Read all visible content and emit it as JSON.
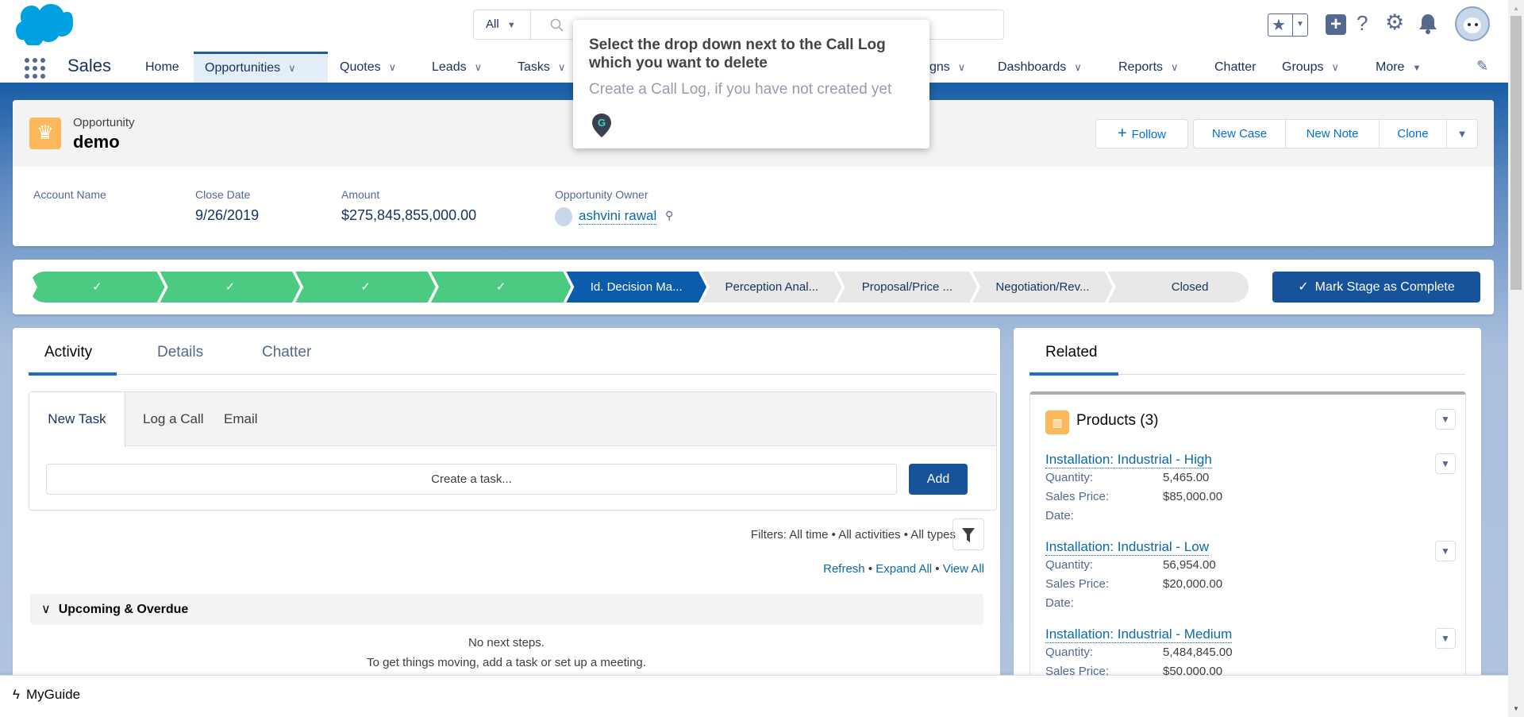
{
  "header": {
    "search_scope": "All",
    "search_placeholder": "",
    "icons": [
      "salesforce-cloud-logo",
      "search-icon",
      "favorites-star-icon",
      "global-create-plus-icon",
      "help-icon",
      "setup-gear-icon",
      "notifications-bell-icon",
      "user-avatar"
    ]
  },
  "nav": {
    "app_name": "Sales",
    "items": [
      {
        "label": "Home",
        "chevron": false
      },
      {
        "label": "Opportunities",
        "chevron": true,
        "active": true
      },
      {
        "label": "Quotes",
        "chevron": true
      },
      {
        "label": "Leads",
        "chevron": true
      },
      {
        "label": "Tasks",
        "chevron": true
      },
      {
        "label": "gns",
        "chevron": true
      },
      {
        "label": "Dashboards",
        "chevron": true
      },
      {
        "label": "Reports",
        "chevron": true
      },
      {
        "label": "Chatter",
        "chevron": false
      },
      {
        "label": "Groups",
        "chevron": true
      },
      {
        "label": "More",
        "chevron": true
      }
    ]
  },
  "tooltip": {
    "title": "Select the drop down next to the Call Log which you want to delete",
    "subtitle": "Create a Call Log, if you have not created yet"
  },
  "record": {
    "object_type": "Opportunity",
    "name": "demo",
    "actions": {
      "follow": "Follow",
      "new_case": "New Case",
      "new_note": "New Note",
      "clone": "Clone"
    },
    "fields": [
      {
        "label": "Account Name",
        "value": ""
      },
      {
        "label": "Close Date",
        "value": "9/26/2019"
      },
      {
        "label": "Amount",
        "value": "$275,845,855,000.00"
      },
      {
        "label": "Opportunity Owner",
        "value": "ashvini rawal"
      }
    ]
  },
  "path": {
    "stages": [
      {
        "label": "",
        "status": "complete"
      },
      {
        "label": "",
        "status": "complete"
      },
      {
        "label": "",
        "status": "complete"
      },
      {
        "label": "",
        "status": "complete"
      },
      {
        "label": "Id. Decision Ma...",
        "status": "current"
      },
      {
        "label": "Perception Anal...",
        "status": "incomplete"
      },
      {
        "label": "Proposal/Price ...",
        "status": "incomplete"
      },
      {
        "label": "Negotiation/Rev...",
        "status": "incomplete"
      },
      {
        "label": "Closed",
        "status": "incomplete"
      }
    ],
    "mark_complete": "Mark Stage as Complete",
    "colors": {
      "complete": "#4bca81",
      "current": "#0b5cab",
      "incomplete": "#e8e8e8"
    }
  },
  "activity": {
    "tabs": [
      "Activity",
      "Details",
      "Chatter"
    ],
    "composer_tabs": [
      "New Task",
      "Log a Call",
      "Email"
    ],
    "task_placeholder": "Create a task...",
    "add": "Add",
    "filters": "Filters: All time • All activities • All types",
    "links": {
      "refresh": "Refresh",
      "expand_all": "Expand All",
      "view_all": "View All"
    },
    "upcoming": "Upcoming & Overdue",
    "empty1": "No next steps.",
    "empty2": "To get things moving, add a task or set up a meeting."
  },
  "related": {
    "tab": "Related",
    "products_title": "Products (3)",
    "labels": {
      "qty": "Quantity:",
      "price": "Sales Price:",
      "date": "Date:"
    },
    "products": [
      {
        "name": "Installation: Industrial - High",
        "quantity": "5,465.00",
        "price": "$85,000.00",
        "date": ""
      },
      {
        "name": "Installation: Industrial - Low",
        "quantity": "56,954.00",
        "price": "$20,000.00",
        "date": ""
      },
      {
        "name": "Installation: Industrial - Medium",
        "quantity": "5,484,845.00",
        "price": "$50,000.00",
        "date": ""
      }
    ]
  },
  "footer": {
    "label": "MyGuide"
  }
}
